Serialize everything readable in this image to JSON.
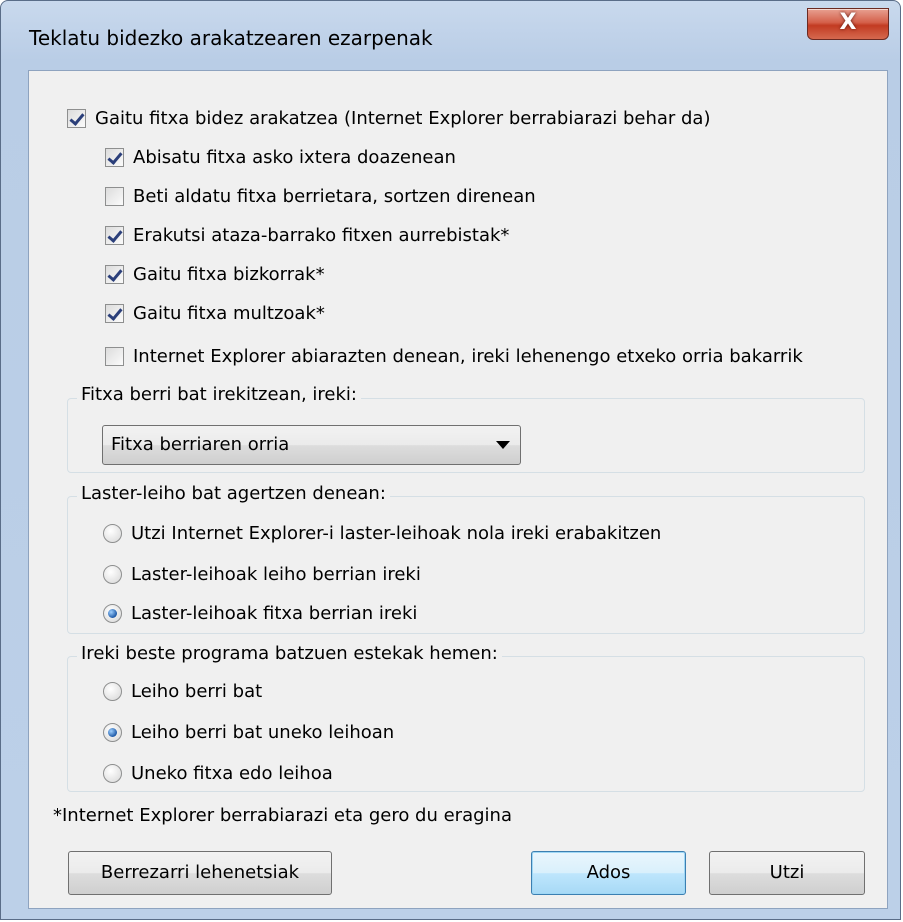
{
  "window": {
    "title": "Teklatu bidezko arakatzearen ezarpenak",
    "close_glyph": "X"
  },
  "main_option": {
    "label": "Gaitu fitxa bidez arakatzea (Internet Explorer berrabiarazi behar da)",
    "checked": true
  },
  "sub_options": [
    {
      "label": "Abisatu fitxa asko ixtera doazenean",
      "checked": true
    },
    {
      "label": "Beti aldatu fitxa berrietara, sortzen direnean",
      "checked": false
    },
    {
      "label": "Erakutsi ataza-barrako fitxen aurrebistak*",
      "checked": true
    },
    {
      "label": "Gaitu fitxa bizkorrak*",
      "checked": true
    },
    {
      "label": "Gaitu fitxa multzoak*",
      "checked": true
    },
    {
      "label": "Internet Explorer abiarazten denean, ireki lehenengo etxeko orria bakarrik",
      "checked": false
    }
  ],
  "new_tab_group": {
    "legend": "Fitxa berri bat irekitzean, ireki:",
    "selected": "Fitxa berriaren orria"
  },
  "popup_group": {
    "legend": "Laster-leiho bat agertzen denean:",
    "options": [
      {
        "label": "Utzi Internet Explorer-i laster-leihoak nola ireki erabakitzen",
        "selected": false
      },
      {
        "label": "Laster-leihoak leiho berrian ireki",
        "selected": false
      },
      {
        "label": "Laster-leihoak fitxa berrian ireki",
        "selected": true
      }
    ]
  },
  "links_group": {
    "legend": "Ireki beste programa batzuen estekak hemen:",
    "options": [
      {
        "label": "Leiho berri bat",
        "selected": false
      },
      {
        "label": "Leiho berri bat uneko leihoan",
        "selected": true
      },
      {
        "label": "Uneko fitxa edo leihoa",
        "selected": false
      }
    ]
  },
  "footnote": "*Internet Explorer berrabiarazi eta gero du eragina",
  "buttons": {
    "restore": "Berrezarri lehenetsiak",
    "ok": "Ados",
    "cancel": "Utzi"
  }
}
